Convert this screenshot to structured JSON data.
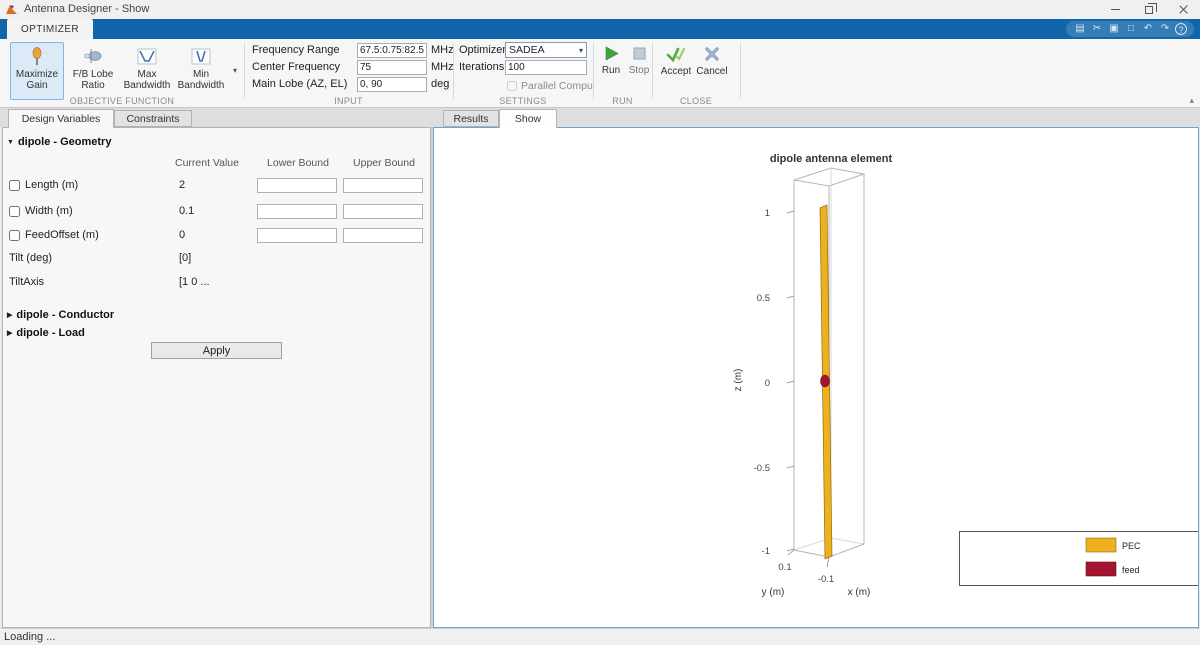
{
  "colors": {
    "ribbon_blue": "#1065ab",
    "pec": "#EDB120",
    "feed": "#A2142F",
    "run_green": "#3fa63f",
    "focus_border": "#6da2d5"
  },
  "icons": {
    "dropdown": "▾",
    "expanded": "▼",
    "collapsed": "▶",
    "ribbon_collapse": "▴"
  },
  "window": {
    "title": "Antenna Designer - Show"
  },
  "quick_access": [
    {
      "name": "save",
      "glyph": "▤"
    },
    {
      "name": "cut",
      "glyph": "✂"
    },
    {
      "name": "copy",
      "glyph": "▣"
    },
    {
      "name": "paste",
      "glyph": "□"
    },
    {
      "name": "undo",
      "glyph": "↶"
    },
    {
      "name": "redo",
      "glyph": "↷"
    },
    {
      "name": "help",
      "glyph": "?"
    }
  ],
  "ribbon": {
    "tab_label": "OPTIMIZER",
    "objective": {
      "section_label": "OBJECTIVE FUNCTION",
      "maximize_gain": "Maximize Gain",
      "fb_lobe_ratio": "F/B Lobe Ratio",
      "max_bandwidth": "Max Bandwidth",
      "min_bandwidth": "Min Bandwidth"
    },
    "input": {
      "section_label": "INPUT",
      "frequency_range_label": "Frequency Range",
      "frequency_range_value": "67.5:0.75:82.5",
      "frequency_range_unit": "MHz",
      "center_frequency_label": "Center Frequency",
      "center_frequency_value": "75",
      "center_frequency_unit": "MHz",
      "main_lobe_label": "Main Lobe (AZ, EL)",
      "main_lobe_value": "0, 90",
      "main_lobe_unit": "deg"
    },
    "settings": {
      "section_label": "SETTINGS",
      "optimizer_label": "Optimizer",
      "optimizer_value": "SADEA",
      "iterations_label": "Iterations",
      "iterations_value": "100",
      "parallel_label": "Parallel Computing"
    },
    "run": {
      "section_label": "RUN",
      "run_label": "Run",
      "stop_label": "Stop"
    },
    "close": {
      "section_label": "CLOSE",
      "accept_label": "Accept",
      "cancel_label": "Cancel"
    }
  },
  "left_panel": {
    "tabs": [
      {
        "label": "Design Variables"
      },
      {
        "label": "Constraints"
      }
    ],
    "sections": {
      "geometry": "dipole - Geometry",
      "conductor": "dipole - Conductor",
      "load": "dipole - Load"
    },
    "columns": {
      "current": "Current Value",
      "lower": "Lower Bound",
      "upper": "Upper Bound"
    },
    "rows": [
      {
        "label": "Length (m)",
        "value": "2"
      },
      {
        "label": "Width (m)",
        "value": "0.1"
      },
      {
        "label": "FeedOffset (m)",
        "value": "0"
      },
      {
        "label": "Tilt (deg)",
        "value": "[0]"
      },
      {
        "label": "TiltAxis",
        "value": "[1  0 ..."
      }
    ],
    "apply_label": "Apply"
  },
  "right_panel": {
    "tabs": [
      {
        "label": "Results"
      },
      {
        "label": "Show"
      }
    ],
    "plot": {
      "title": "dipole antenna element",
      "z_axis_label": "z (m)",
      "y_axis_label": "y (m)",
      "x_axis_label": "x (m)",
      "z_ticks": [
        "1",
        "0.5",
        "0",
        "-0.5",
        "-1"
      ],
      "x_ticks": [
        "0.1",
        "-0.1"
      ],
      "legend": [
        {
          "label": "PEC"
        },
        {
          "label": "feed"
        }
      ]
    }
  },
  "status_bar": {
    "text": "Loading ..."
  }
}
